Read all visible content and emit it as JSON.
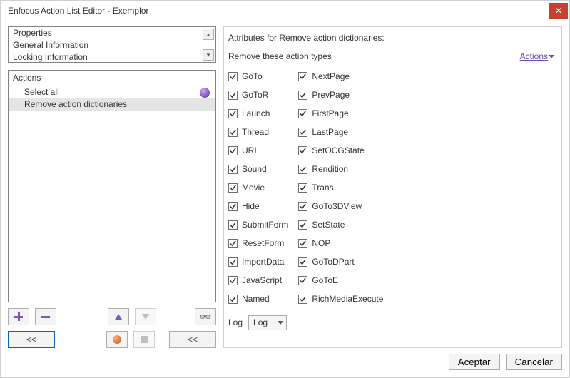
{
  "window": {
    "title": "Enfocus Action List Editor - Exemplor"
  },
  "left": {
    "top_items": [
      "Properties",
      "General Information",
      "Locking Information"
    ],
    "actions_header": "Actions",
    "actions": [
      {
        "label": "Select all",
        "selected": false
      },
      {
        "label": "Remove action dictionaries",
        "selected": true
      }
    ]
  },
  "right": {
    "title": "Attributes for Remove action dictionaries:",
    "subtitle": "Remove these action types",
    "actions_link": "Actions",
    "columns": [
      [
        "GoTo",
        "GoToR",
        "Launch",
        "Thread",
        "URI",
        "Sound",
        "Movie",
        "Hide",
        "SubmitForm",
        "ResetForm",
        "ImportData",
        "JavaScript",
        "Named"
      ],
      [
        "NextPage",
        "PrevPage",
        "FirstPage",
        "LastPage",
        "SetOCGState",
        "Rendition",
        "Trans",
        "GoTo3DView",
        "SetState",
        "NOP",
        "GoToDPart",
        "GoToE",
        "RichMediaExecute"
      ]
    ],
    "log_label": "Log",
    "log_value": "Log"
  },
  "footer": {
    "accept": "Aceptar",
    "cancel": "Cancelar"
  },
  "toolbar": {
    "double_left": "<<"
  }
}
